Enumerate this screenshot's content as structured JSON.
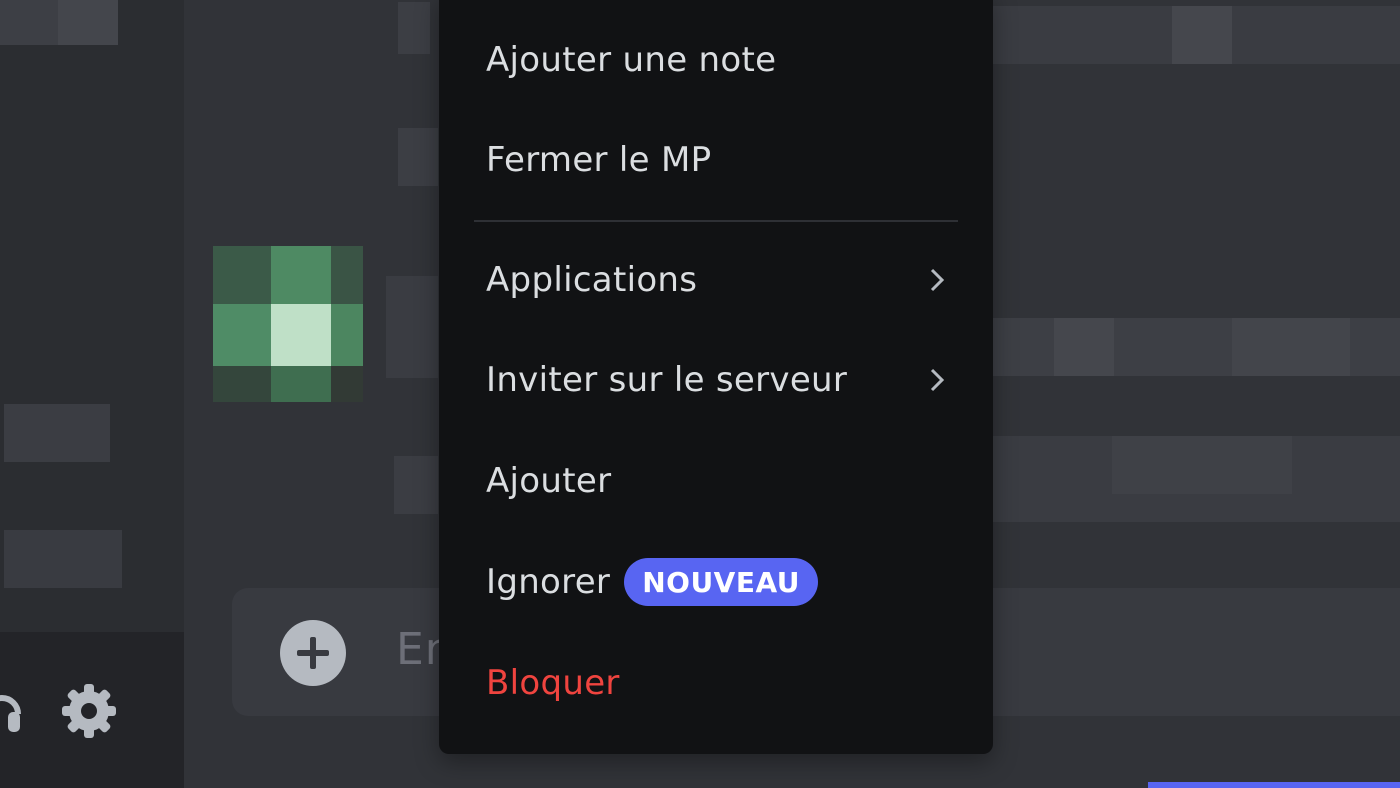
{
  "colors": {
    "background": "#313338",
    "sidebar": "#2b2d31",
    "menu_background": "#111214",
    "menu_text": "#dbdee1",
    "danger": "#f0443f",
    "badge_background": "#5865f2"
  },
  "context_menu": {
    "items": [
      {
        "label": "Ajouter une note"
      },
      {
        "label": "Fermer le MP"
      },
      {
        "label": "Applications",
        "has_submenu": true
      },
      {
        "label": "Inviter sur le serveur",
        "has_submenu": true
      },
      {
        "label": "Ajouter"
      },
      {
        "label": "Ignorer",
        "badge": "NOUVEAU"
      },
      {
        "label": "Bloquer",
        "danger": true
      }
    ]
  },
  "composer": {
    "placeholder": "En",
    "add_icon": "plus-circle-icon"
  },
  "user_panel": {
    "icons": [
      "headset-icon",
      "gear-icon"
    ]
  }
}
